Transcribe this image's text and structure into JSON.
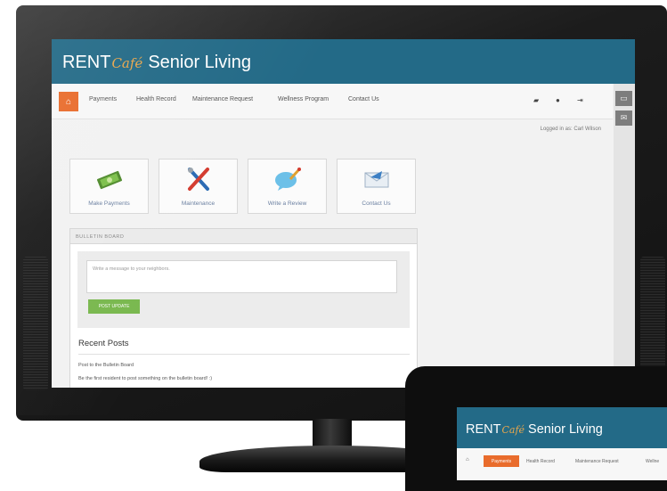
{
  "brand": {
    "prefix": "RENT",
    "script": "Café",
    "suffix": "Senior Living"
  },
  "nav": {
    "home_icon": "home-icon",
    "items": [
      "Payments",
      "Health Record",
      "Maintenance Request",
      "Wellness Program",
      "Contact Us"
    ],
    "right_icons": [
      "folder-icon",
      "user-icon",
      "logout-icon"
    ]
  },
  "side_rail": {
    "icons": [
      "chat-icon",
      "mail-icon"
    ]
  },
  "logged_in": "Logged in as: Carl Wilson",
  "tiles": [
    {
      "label": "Make Payments",
      "icon": "money-icon"
    },
    {
      "label": "Maintenance",
      "icon": "tools-icon"
    },
    {
      "label": "Write a Review",
      "icon": "review-icon"
    },
    {
      "label": "Contact Us",
      "icon": "envelope-icon"
    }
  ],
  "bulletin": {
    "title": "BULLETIN BOARD",
    "placeholder": "Write a message to your neighbors.",
    "post_button": "POST UPDATE",
    "recent_title": "Recent Posts",
    "posts": [
      "Post to the Bulletin Board",
      "Be the first resident to post something on the bulletin board! :)"
    ]
  },
  "tablet": {
    "nav_items": [
      "Payments",
      "Health Record",
      "Maintenance Request",
      "Wellne"
    ]
  },
  "colors": {
    "header": "#236a87",
    "accent": "#e96c2c",
    "post_button": "#79b84e",
    "script": "#e9a64b"
  }
}
